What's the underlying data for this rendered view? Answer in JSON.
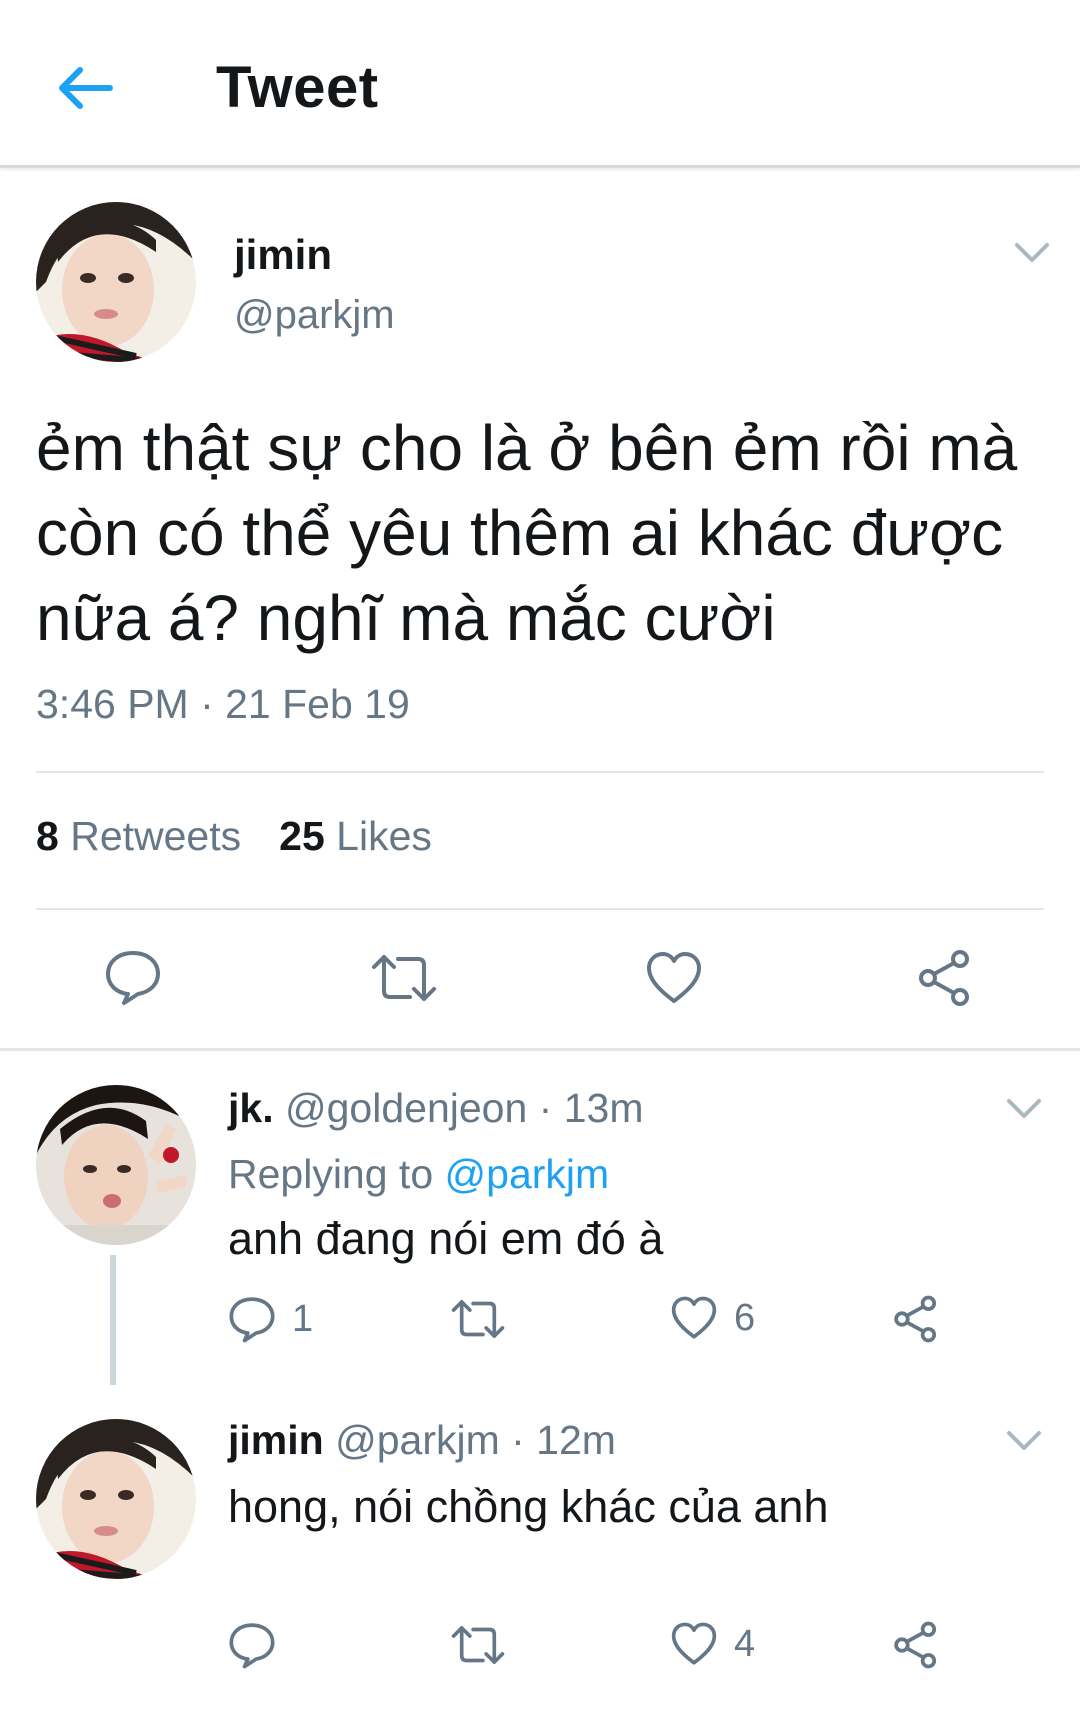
{
  "header": {
    "title": "Tweet",
    "back_icon": "arrow-left-icon"
  },
  "colors": {
    "accent": "#1da1f2",
    "secondary_text": "#657786",
    "divider": "#e1e8ed"
  },
  "main_tweet": {
    "name": "jimin",
    "handle": "@parkjm",
    "text": "ẻm thật sự cho là ở bên ẻm rồi mà còn có thể yêu thêm ai khác được nữa á? nghĩ mà mắc cười",
    "timestamp": "3:46 PM · 21 Feb 19",
    "retweets_count": "8",
    "retweets_label": "Retweets",
    "likes_count": "25",
    "likes_label": "Likes"
  },
  "replies": [
    {
      "name": "jk.",
      "handle": "@goldenjeon",
      "time": "· 13m",
      "replying_prefix": "Replying to",
      "replying_to": "@parkjm",
      "text": "anh đang nói em đó à",
      "reply_count": "1",
      "retweet_count": "",
      "like_count": "6"
    },
    {
      "name": "jimin",
      "handle": "@parkjm",
      "time": "· 12m",
      "text": "hong, nói chồng khác của anh",
      "reply_count": "",
      "retweet_count": "",
      "like_count": "4"
    }
  ]
}
